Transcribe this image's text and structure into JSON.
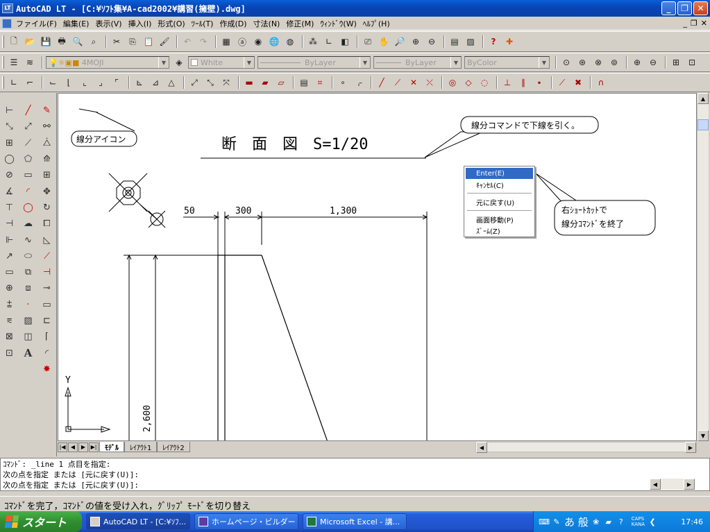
{
  "titlebar": {
    "title": "AutoCAD LT - [C:¥ｿﾌﾄ集¥A-cad2002¥講習(擁壁).dwg]",
    "icon": "LT"
  },
  "window_buttons": [
    "_",
    "❐",
    "✕"
  ],
  "menubar": {
    "items": [
      "ファイル(F)",
      "編集(E)",
      "表示(V)",
      "挿入(I)",
      "形式(O)",
      "ﾂｰﾙ(T)",
      "作成(D)",
      "寸法(N)",
      "修正(M)",
      "ｳｨﾝﾄﾞｳ(W)",
      "ﾍﾙﾌﾟ(H)"
    ]
  },
  "properties_bar": {
    "layer": "4MOJI",
    "color": "White",
    "linetype": "ByLayer",
    "lineweight": "ByLayer",
    "plotstyle": "ByColor"
  },
  "drawing": {
    "title": "断　面　図　S=1/20",
    "dim_50": "50",
    "dim_300": "300",
    "dim_1300": "1,300",
    "dim_2600": "2,600",
    "axis_y": "Y",
    "callout_icon": "線分アイコン",
    "callout_command": "線分コマンドで下線を引く。",
    "callout_right_line1": "右ｼｮｰﾄｶｯﾄで",
    "callout_right_line2": "線分ｺﾏﾝﾄﾞを終了"
  },
  "context_menu": {
    "items": [
      "Enter(E)",
      "ｷｬﾝｾﾙ(C)",
      "元に戻す(U)",
      "画面移動(P)",
      "ｽﾞｰﾑ(Z)"
    ]
  },
  "tabs": [
    "ﾓﾃﾞﾙ",
    "ﾚｲｱｳﾄ1",
    "ﾚｲｱｳﾄ2"
  ],
  "command": {
    "line1": "ｺﾏﾝﾄﾞ: _line 1 点目を指定:",
    "line2": "次の点を指定 または [元に戻す(U)]:",
    "line3": "次の点を指定 または [元に戻す(U)]:"
  },
  "status_text": "ｺﾏﾝﾄﾞを完了，ｺﾏﾝﾄﾞの値を受け入れ，ｸﾞﾘｯﾌﾟ ﾓｰﾄﾞを切り替え",
  "taskbar": {
    "start": "スタート",
    "tasks": [
      "AutoCAD LT - [C:¥ｿﾌ...",
      "ホームページ・ビルダー ...",
      "Microsoft Excel - 講..."
    ],
    "ime": "あ 般",
    "caps": "CAPS",
    "kana": "KANA",
    "clock": "17:46"
  }
}
